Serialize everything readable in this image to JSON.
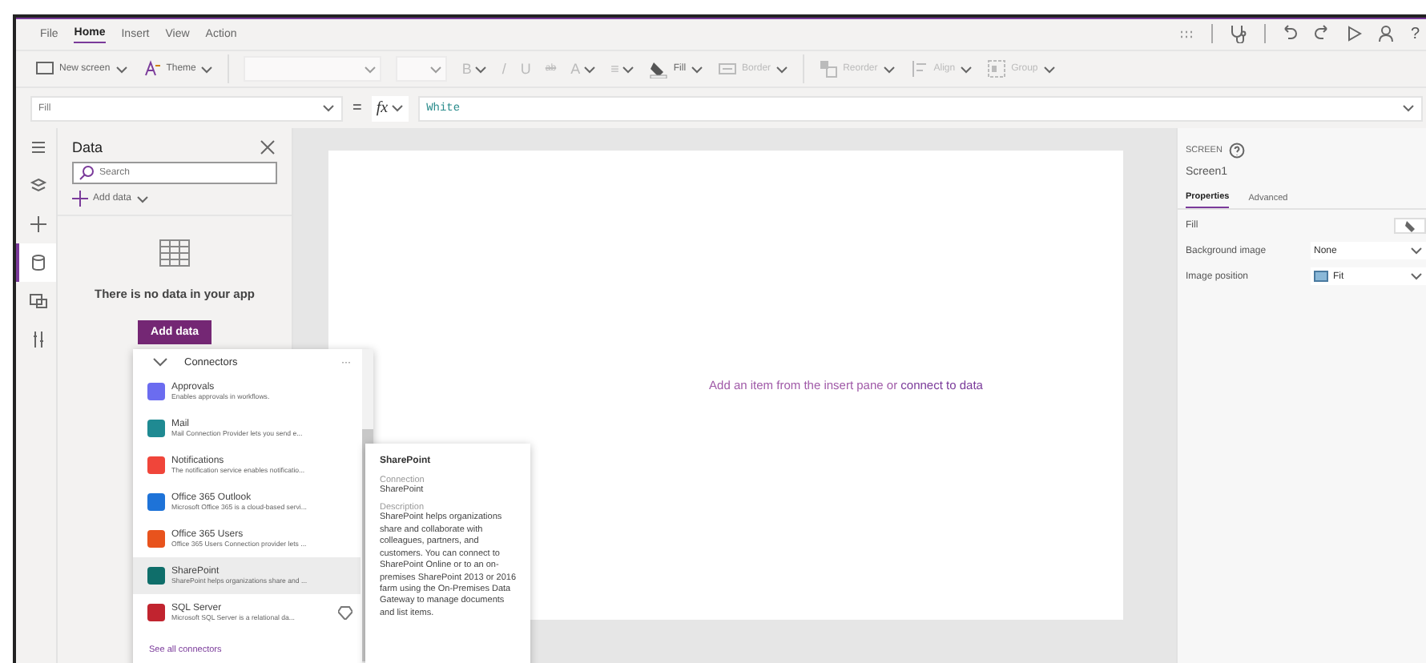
{
  "menu": {
    "tabs": [
      {
        "label": "File",
        "selected": false
      },
      {
        "label": "Home",
        "selected": true
      },
      {
        "label": "Insert",
        "selected": false
      },
      {
        "label": "View",
        "selected": false
      },
      {
        "label": "Action",
        "selected": false
      }
    ]
  },
  "menu_help": "?",
  "toolbar": {
    "left_buttons": [
      {
        "label": "New screen",
        "disabled": false
      },
      {
        "label": "Theme",
        "disabled": false
      }
    ],
    "format_buttons": [
      {
        "label": "B",
        "disabled": true
      },
      {
        "label": "/",
        "disabled": true
      },
      {
        "label": "U",
        "disabled": true
      },
      {
        "label": "ab",
        "disabled": true
      },
      {
        "label": "A",
        "disabled": true
      },
      {
        "label": "≡",
        "disabled": true
      }
    ],
    "right_buttons": [
      {
        "label": "Fill",
        "disabled": false
      },
      {
        "label": "Border",
        "disabled": true
      },
      {
        "label": "Reorder",
        "disabled": true
      },
      {
        "label": "Align",
        "disabled": true
      },
      {
        "label": "Group",
        "disabled": true
      }
    ]
  },
  "formula": {
    "property": "Fill",
    "equals": "=",
    "fx": "fx",
    "value": "White"
  },
  "rail": [
    {
      "kind": "menu",
      "selected": false
    },
    {
      "kind": "tree",
      "selected": false
    },
    {
      "kind": "insert",
      "selected": false
    },
    {
      "kind": "data",
      "selected": true
    },
    {
      "kind": "media",
      "selected": false
    },
    {
      "kind": "tools",
      "selected": false
    }
  ],
  "data_pane": {
    "title": "Data",
    "search": {
      "placeholder": "Search"
    },
    "add_link": "Add data",
    "empty_message": "There is no data in your app",
    "add_button": "Add data"
  },
  "connectors": {
    "header": "Connectors",
    "more": "···",
    "items": [
      {
        "name": "Approvals",
        "description": "Enables approvals in workflows.",
        "color": "#6b6cf0",
        "selected": false,
        "premium": false
      },
      {
        "name": "Mail",
        "description": "Mail Connection Provider lets you send e...",
        "color": "#1f8a92",
        "selected": false,
        "premium": false
      },
      {
        "name": "Notifications",
        "description": "The notification service enables notificatio...",
        "color": "#f0453a",
        "selected": false,
        "premium": false
      },
      {
        "name": "Office 365 Outlook",
        "description": "Microsoft Office 365 is a cloud-based servi...",
        "color": "#1e73d8",
        "selected": false,
        "premium": false
      },
      {
        "name": "Office 365 Users",
        "description": "Office 365 Users Connection provider lets ...",
        "color": "#e8531d",
        "selected": false,
        "premium": false
      },
      {
        "name": "SharePoint",
        "description": "SharePoint helps organizations share and ...",
        "color": "#0f6e6a",
        "selected": true,
        "premium": false
      },
      {
        "name": "SQL Server",
        "description": "Microsoft SQL Server is a relational da...",
        "color": "#c1242f",
        "selected": false,
        "premium": true
      }
    ],
    "see_all": "See all connectors"
  },
  "tooltip": {
    "title": "SharePoint",
    "connection_label": "Connection",
    "connection_value": "SharePoint",
    "description_label": "Description",
    "description": "SharePoint helps organizations share and collaborate with colleagues, partners, and customers. You can connect to SharePoint Online or to an on-premises SharePoint 2013 or 2016 farm using the On-Premises Data Gateway to manage documents and list items."
  },
  "canvas": {
    "hint": "Add an item from the insert pane or",
    "link": "connect to data"
  },
  "properties": {
    "heading": "SCREEN",
    "name": "Screen1",
    "tabs": [
      {
        "label": "Properties",
        "selected": true
      },
      {
        "label": "Advanced",
        "selected": false
      }
    ],
    "rows": [
      {
        "kind": "color",
        "label": "Fill"
      },
      {
        "kind": "dropdown",
        "label": "Background image",
        "value": "None"
      },
      {
        "kind": "dropdown",
        "label": "Image position",
        "value": "Fit",
        "icon": true
      }
    ]
  }
}
